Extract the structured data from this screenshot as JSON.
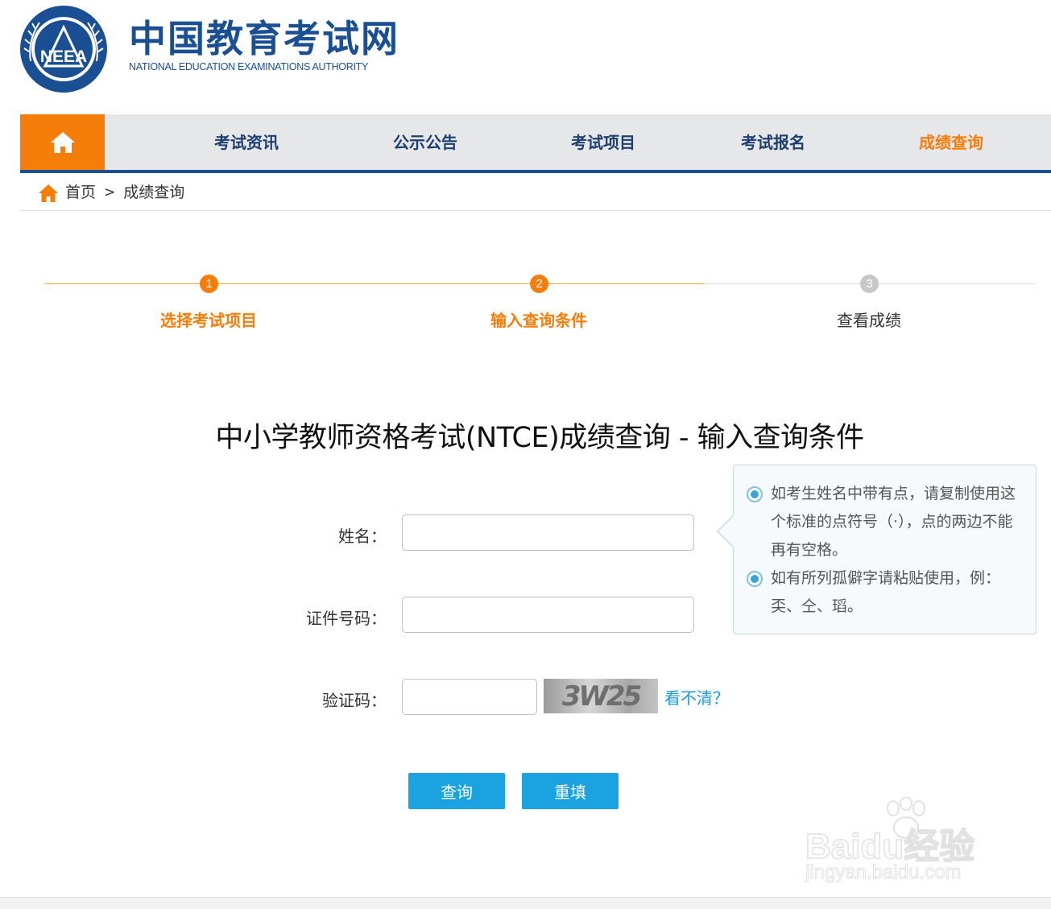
{
  "header": {
    "logo_cn": "中国教育考试网",
    "logo_en": "NATIONAL EDUCATION EXAMINATIONS AUTHORITY",
    "emblem_text": "NEEA"
  },
  "nav": {
    "home_icon": "home-icon",
    "items": [
      {
        "label": "考试资讯"
      },
      {
        "label": "公示公告"
      },
      {
        "label": "考试项目"
      },
      {
        "label": "考试报名"
      },
      {
        "label": "成绩查询",
        "active": true
      }
    ]
  },
  "breadcrumb": {
    "home": "首页",
    "separator": ">",
    "current": "成绩查询"
  },
  "steps": [
    {
      "number": "1",
      "label": "选择考试项目",
      "status": "done"
    },
    {
      "number": "2",
      "label": "输入查询条件",
      "status": "done"
    },
    {
      "number": "3",
      "label": "查看成绩",
      "status": "todo"
    }
  ],
  "form": {
    "title": "中小学教师资格考试(NTCE)成绩查询 - 输入查询条件",
    "name_label": "姓名：",
    "name_value": "",
    "id_label": "证件号码：",
    "id_value": "",
    "captcha_label": "验证码：",
    "captcha_value": "",
    "captcha_image_text": "3W25",
    "captcha_refresh": "看不清？",
    "submit": "查询",
    "reset": "重填"
  },
  "tips": [
    "如考生姓名中带有点，请复制使用这个标准的点符号（·），点的两边不能再有空格。",
    "如有所列孤僻字请粘贴使用，例：奀、仝、瑫。"
  ],
  "watermark": {
    "brand": "Baidu经验",
    "url": "jingyan.baidu.com"
  },
  "colors": {
    "accent_orange": "#f57d0a",
    "brand_blue": "#1a4f94",
    "button_blue": "#1aa3e0",
    "inactive_gray": "#c8c8c8"
  }
}
